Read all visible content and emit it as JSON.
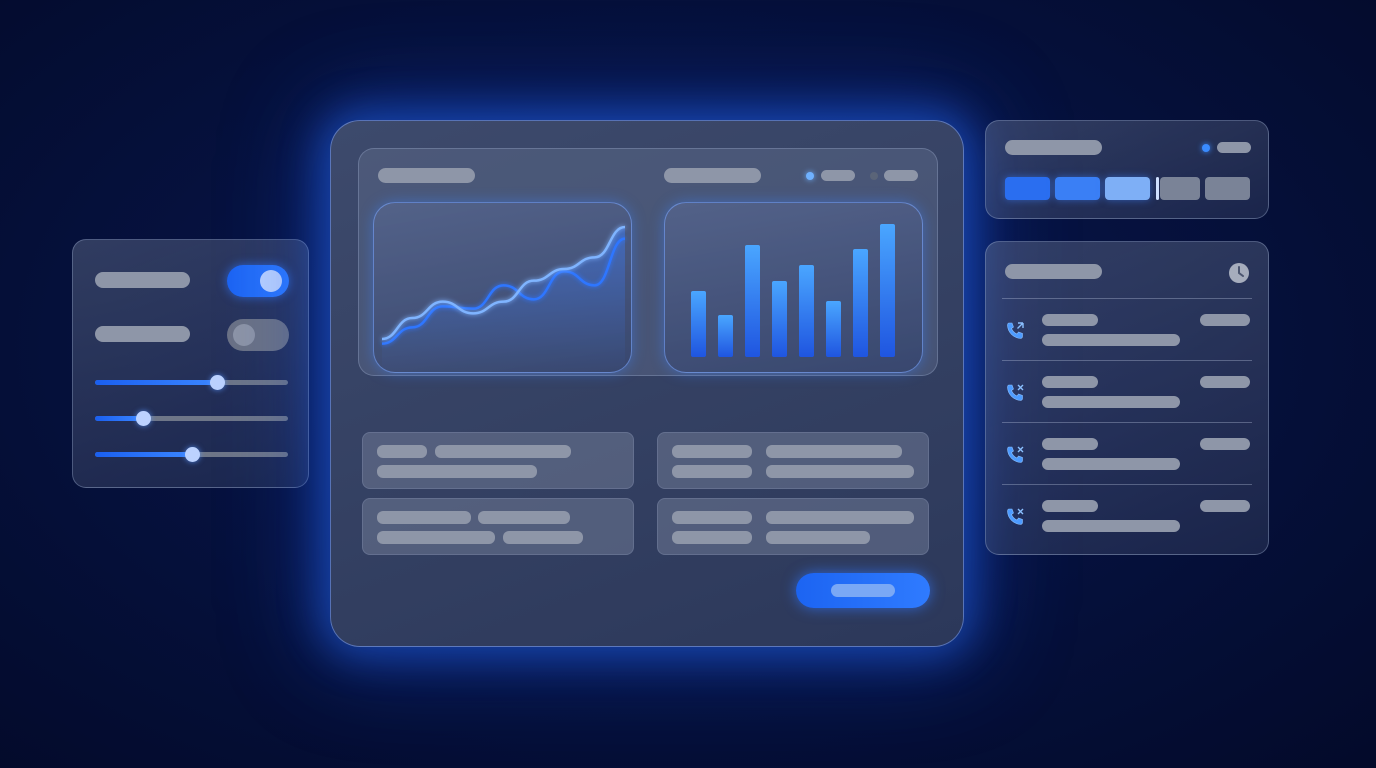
{
  "theme": {
    "accent": "#2f7bff",
    "accent_light": "#89b4f8",
    "background": "#061240"
  },
  "settings_panel": {
    "toggles": [
      {
        "state": "on"
      },
      {
        "state": "off"
      }
    ],
    "sliders": [
      {
        "value_percent": 63
      },
      {
        "value_percent": 25
      },
      {
        "value_percent": 50
      }
    ]
  },
  "main_window": {
    "header_indicators": [
      {
        "color": "#6fb1ff"
      },
      {
        "color": "#5a6478"
      }
    ],
    "charts": [
      {
        "type": "line",
        "series": [
          {
            "values": [
              8,
              22,
              40,
              38,
              58,
              46,
              70,
              58,
              98
            ]
          },
          {
            "values": [
              12,
              30,
              44,
              34,
              44,
              62,
              72,
              82,
              108
            ]
          }
        ]
      },
      {
        "type": "bar",
        "values": [
          66,
          42,
          112,
          76,
          92,
          56,
          108,
          133
        ]
      }
    ],
    "primary_button": {
      "icon": "none"
    }
  },
  "segments_panel": {
    "indicator": {
      "color": "#3a8bff"
    },
    "segments": [
      {
        "color": "#2a6ef0"
      },
      {
        "color": "#3a7ff5"
      },
      {
        "color": "#7eaff6"
      },
      {
        "color": "#7a8397"
      },
      {
        "color": "#7a8397"
      }
    ]
  },
  "calls_panel": {
    "header_icon": "clock-icon",
    "calls": [
      {
        "icon": "incoming-call-icon"
      },
      {
        "icon": "missed-call-icon"
      },
      {
        "icon": "missed-call-icon"
      },
      {
        "icon": "missed-call-icon"
      }
    ]
  }
}
